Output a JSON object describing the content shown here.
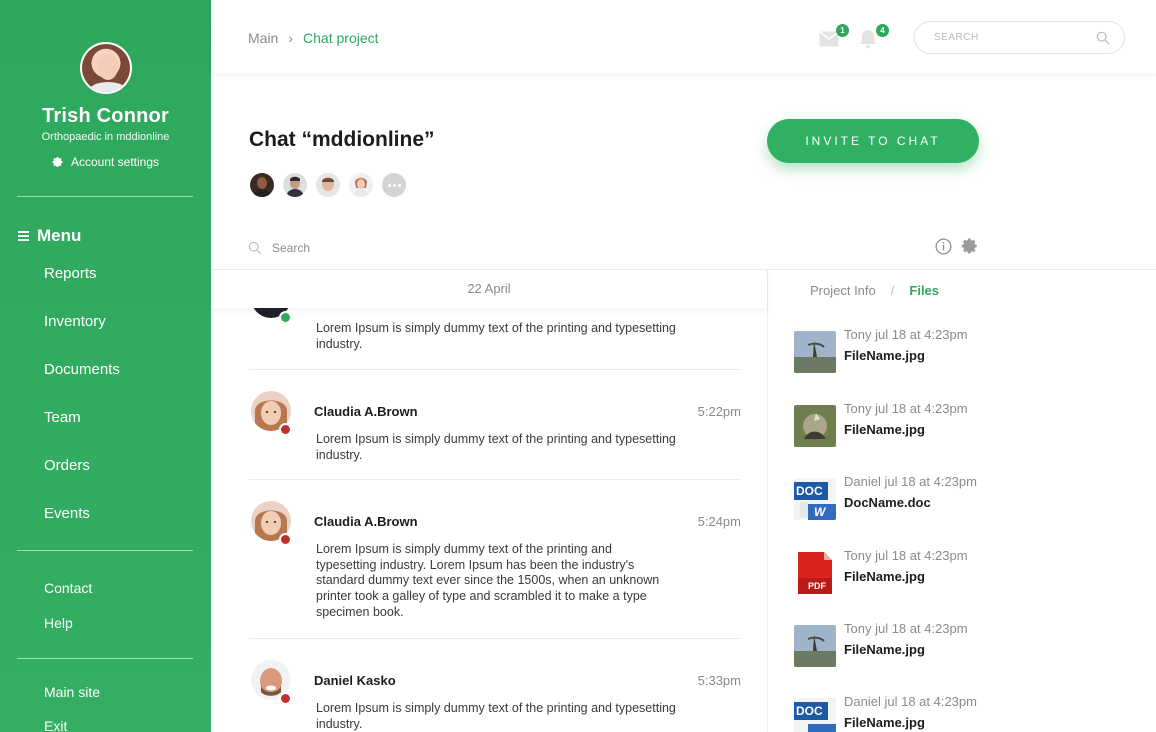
{
  "profile": {
    "name": "Trish Connor",
    "role": "Orthopaedic in mddionline",
    "settings_label": "Account settings"
  },
  "menu": {
    "title": "Menu",
    "items": [
      "Reports",
      "Inventory",
      "Documents",
      "Team",
      "Orders",
      "Events"
    ],
    "secondary": [
      "Contact",
      "Help"
    ],
    "footer": [
      "Main site",
      "Exit"
    ]
  },
  "header": {
    "breadcrumb": {
      "root": "Main",
      "separator": "›",
      "current": "Chat project"
    },
    "mail_count": "1",
    "notification_count": "4",
    "search_placeholder": "SEARCH"
  },
  "chat": {
    "title": "Chat “mddionline”",
    "invite_label": "INVITE TO CHAT",
    "search_placeholder": "Search",
    "date_label": "22 April",
    "messages": [
      {
        "author": "",
        "time": "",
        "text": "Lorem Ipsum is simply dummy text of the printing and typesetting industry.",
        "status": "online"
      },
      {
        "author": "Claudia A.Brown",
        "time": "5:22pm",
        "text": "Lorem Ipsum is simply dummy text of the printing and typesetting industry.",
        "status": "offline"
      },
      {
        "author": "Claudia A.Brown",
        "time": "5:24pm",
        "text": "Lorem Ipsum is simply dummy text of the printing and typesetting industry. Lorem Ipsum has been the industry's standard dummy text ever since the 1500s, when an unknown printer took a galley of type and scrambled it to make a type specimen book.",
        "status": "offline"
      },
      {
        "author": "Daniel Kasko",
        "time": "5:33pm",
        "text": "Lorem Ipsum is simply dummy text of the printing and typesetting industry.",
        "status": "offline"
      }
    ]
  },
  "panel": {
    "tabs": [
      "Project Info",
      "Files"
    ],
    "separator": "/",
    "active_tab": "Files",
    "files": [
      {
        "meta": "Tony  jul 18 at 4:23pm",
        "name": "FileName.jpg",
        "type": "image"
      },
      {
        "meta": "Tony  jul 18 at 4:23pm",
        "name": "FileName.jpg",
        "type": "image"
      },
      {
        "meta": "Daniel  jul 18 at 4:23pm",
        "name": "DocName.doc",
        "type": "doc"
      },
      {
        "meta": "Tony  jul 18 at 4:23pm",
        "name": "FileName.jpg",
        "type": "pdf"
      },
      {
        "meta": "Tony  jul 18 at 4:23pm",
        "name": "FileName.jpg",
        "type": "image"
      },
      {
        "meta": "Daniel  jul 18 at 4:23pm",
        "name": "FileName.jpg",
        "type": "doc"
      }
    ],
    "doc_label": "DOC",
    "doc_sub": "W",
    "pdf_label": "PDF"
  },
  "colors": {
    "accent": "#2ea85c",
    "online": "#2ea85c",
    "offline": "#c0302b"
  }
}
